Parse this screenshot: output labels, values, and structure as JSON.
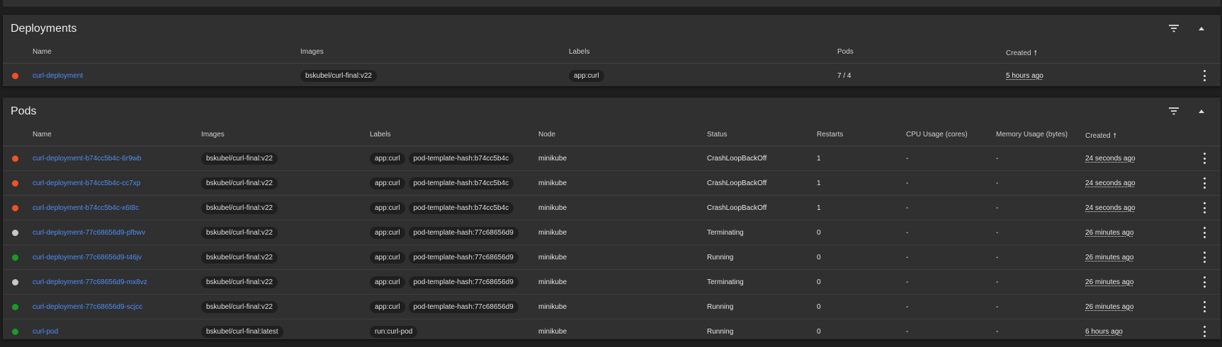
{
  "colors": {
    "failing": "#f2521f",
    "running": "#1a9b25",
    "terminating": "#c8c8c8",
    "link": "#4f8ef7"
  },
  "deployments": {
    "title": "Deployments",
    "filter_icon": "filter-list-icon",
    "collapse_icon": "chevron-up-icon",
    "columns": {
      "name": "Name",
      "images": "Images",
      "labels": "Labels",
      "pods": "Pods",
      "created": "Created"
    },
    "rows": [
      {
        "status": "failing",
        "name": "curl-deployment",
        "image": "bskubel/curl-final:v22",
        "labels": [
          "app:curl"
        ],
        "pods": "7 / 4",
        "created": "5 hours ago"
      }
    ]
  },
  "pods": {
    "title": "Pods",
    "filter_icon": "filter-list-icon",
    "collapse_icon": "chevron-up-icon",
    "columns": {
      "name": "Name",
      "images": "Images",
      "labels": "Labels",
      "node": "Node",
      "status": "Status",
      "restarts": "Restarts",
      "cpu": "CPU Usage (cores)",
      "memory": "Memory Usage (bytes)",
      "created": "Created"
    },
    "rows": [
      {
        "status_kind": "failing",
        "name": "curl-deployment-b74cc5b4c-6r9wb",
        "image": "bskubel/curl-final:v22",
        "labels": [
          "app:curl",
          "pod-template-hash:b74cc5b4c"
        ],
        "node": "minikube",
        "status": "CrashLoopBackOff",
        "restarts": "1",
        "cpu": "-",
        "memory": "-",
        "created": "24 seconds ago"
      },
      {
        "status_kind": "failing",
        "name": "curl-deployment-b74cc5b4c-cc7xp",
        "image": "bskubel/curl-final:v22",
        "labels": [
          "app:curl",
          "pod-template-hash:b74cc5b4c"
        ],
        "node": "minikube",
        "status": "CrashLoopBackOff",
        "restarts": "1",
        "cpu": "-",
        "memory": "-",
        "created": "24 seconds ago"
      },
      {
        "status_kind": "failing",
        "name": "curl-deployment-b74cc5b4c-x6t8c",
        "image": "bskubel/curl-final:v22",
        "labels": [
          "app:curl",
          "pod-template-hash:b74cc5b4c"
        ],
        "node": "minikube",
        "status": "CrashLoopBackOff",
        "restarts": "1",
        "cpu": "-",
        "memory": "-",
        "created": "24 seconds ago"
      },
      {
        "status_kind": "terminating",
        "name": "curl-deployment-77c68656d9-pfbwv",
        "image": "bskubel/curl-final:v22",
        "labels": [
          "app:curl",
          "pod-template-hash:77c68656d9"
        ],
        "node": "minikube",
        "status": "Terminating",
        "restarts": "0",
        "cpu": "-",
        "memory": "-",
        "created": "26 minutes ago"
      },
      {
        "status_kind": "running",
        "name": "curl-deployment-77c68656d9-t46jv",
        "image": "bskubel/curl-final:v22",
        "labels": [
          "app:curl",
          "pod-template-hash:77c68656d9"
        ],
        "node": "minikube",
        "status": "Running",
        "restarts": "0",
        "cpu": "-",
        "memory": "-",
        "created": "26 minutes ago"
      },
      {
        "status_kind": "terminating",
        "name": "curl-deployment-77c68656d9-mx8vz",
        "image": "bskubel/curl-final:v22",
        "labels": [
          "app:curl",
          "pod-template-hash:77c68656d9"
        ],
        "node": "minikube",
        "status": "Terminating",
        "restarts": "0",
        "cpu": "-",
        "memory": "-",
        "created": "26 minutes ago"
      },
      {
        "status_kind": "running",
        "name": "curl-deployment-77c68656d9-scjcc",
        "image": "bskubel/curl-final:v22",
        "labels": [
          "app:curl",
          "pod-template-hash:77c68656d9"
        ],
        "node": "minikube",
        "status": "Running",
        "restarts": "0",
        "cpu": "-",
        "memory": "-",
        "created": "26 minutes ago"
      },
      {
        "status_kind": "running",
        "name": "curl-pod",
        "image": "bskubel/curl-final:latest",
        "labels": [
          "run:curl-pod"
        ],
        "node": "minikube",
        "status": "Running",
        "restarts": "0",
        "cpu": "-",
        "memory": "-",
        "created": "6 hours ago"
      }
    ]
  }
}
